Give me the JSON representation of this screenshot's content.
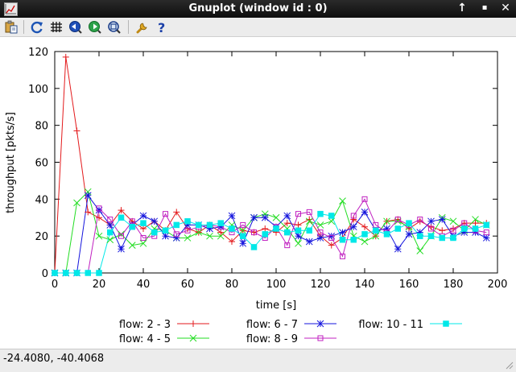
{
  "window": {
    "title": "Gnuplot (window id : 0)",
    "pin_glyph": "↑",
    "min_glyph": "▪",
    "close_glyph": "✕"
  },
  "toolbar": {
    "icons": [
      "copy-clipboard-icon",
      "replot-icon",
      "grid-icon",
      "zoom-previous-icon",
      "zoom-next-icon",
      "autoscale-icon",
      "settings-icon",
      "help-icon"
    ]
  },
  "status": {
    "coords": "-24.4080, -40.4068"
  },
  "colors": {
    "flow_2_3": "#e31a1c",
    "flow_4_5": "#22dd22",
    "flow_6_7": "#1515dd",
    "flow_8_9": "#c020c0",
    "flow_10_11": "#00e8e8"
  },
  "chart_data": {
    "type": "line",
    "xlabel": "time [s]",
    "ylabel": "throughput [pkts/s]",
    "xlim": [
      0,
      200
    ],
    "ylim": [
      0,
      120
    ],
    "xticks": [
      0,
      20,
      40,
      60,
      80,
      100,
      120,
      140,
      160,
      180,
      200
    ],
    "yticks": [
      0,
      20,
      40,
      60,
      80,
      100,
      120
    ],
    "grid": false,
    "legend_position": "bottom",
    "series": [
      {
        "name": "flow: 2 - 3",
        "marker": "plus",
        "color": "#e31a1c",
        "x": [
          0,
          5,
          10,
          15,
          20,
          25,
          30,
          35,
          40,
          45,
          50,
          55,
          60,
          65,
          70,
          75,
          80,
          85,
          90,
          95,
          100,
          105,
          110,
          115,
          120,
          125,
          130,
          135,
          140,
          145,
          150,
          155,
          160,
          165,
          170,
          175,
          180,
          185,
          190,
          195
        ],
        "y": [
          0,
          117,
          77,
          33,
          30,
          26,
          34,
          28,
          24,
          28,
          23,
          33,
          24,
          22,
          26,
          22,
          17,
          23,
          22,
          24,
          22,
          27,
          26,
          29,
          20,
          15,
          19,
          29,
          25,
          20,
          28,
          29,
          24,
          28,
          25,
          23,
          24,
          27,
          27,
          27
        ]
      },
      {
        "name": "flow: 4 - 5",
        "marker": "x",
        "color": "#22dd22",
        "x": [
          0,
          5,
          10,
          15,
          20,
          25,
          30,
          35,
          40,
          45,
          50,
          55,
          60,
          65,
          70,
          75,
          80,
          85,
          90,
          95,
          100,
          105,
          110,
          115,
          120,
          125,
          130,
          135,
          140,
          145,
          150,
          155,
          160,
          165,
          170,
          175,
          180,
          185,
          190,
          195
        ],
        "y": [
          0,
          0,
          38,
          44,
          20,
          18,
          21,
          15,
          16,
          24,
          23,
          19,
          19,
          22,
          20,
          20,
          26,
          23,
          30,
          32,
          30,
          24,
          16,
          28,
          26,
          28,
          39,
          20,
          17,
          20,
          28,
          28,
          25,
          12,
          20,
          30,
          28,
          23,
          29,
          26
        ]
      },
      {
        "name": "flow: 6 - 7",
        "marker": "star",
        "color": "#1515dd",
        "x": [
          0,
          5,
          10,
          15,
          20,
          25,
          30,
          35,
          40,
          45,
          50,
          55,
          60,
          65,
          70,
          75,
          80,
          85,
          90,
          95,
          100,
          105,
          110,
          115,
          120,
          125,
          130,
          135,
          140,
          145,
          150,
          155,
          160,
          165,
          170,
          175,
          180,
          185,
          190,
          195
        ],
        "y": [
          0,
          0,
          0,
          42,
          34,
          26,
          13,
          26,
          31,
          28,
          20,
          19,
          26,
          26,
          24,
          25,
          31,
          16,
          30,
          30,
          25,
          31,
          20,
          17,
          19,
          20,
          22,
          25,
          33,
          23,
          24,
          13,
          21,
          22,
          28,
          29,
          20,
          22,
          22,
          19
        ]
      },
      {
        "name": "flow: 8 - 9",
        "marker": "box",
        "color": "#c020c0",
        "x": [
          0,
          5,
          10,
          15,
          20,
          25,
          30,
          35,
          40,
          45,
          50,
          55,
          60,
          65,
          70,
          75,
          80,
          85,
          90,
          95,
          100,
          105,
          110,
          115,
          120,
          125,
          130,
          135,
          140,
          145,
          150,
          155,
          160,
          165,
          170,
          175,
          180,
          185,
          190,
          195
        ],
        "y": [
          0,
          0,
          0,
          0,
          35,
          29,
          20,
          28,
          19,
          20,
          32,
          21,
          23,
          25,
          26,
          25,
          22,
          26,
          22,
          19,
          25,
          15,
          32,
          33,
          22,
          19,
          9,
          31,
          40,
          26,
          22,
          29,
          26,
          29,
          24,
          20,
          23,
          27,
          23,
          22
        ]
      },
      {
        "name": "flow: 10 - 11",
        "marker": "filled-box",
        "color": "#00e8e8",
        "x": [
          0,
          5,
          10,
          15,
          20,
          25,
          30,
          35,
          40,
          45,
          50,
          55,
          60,
          65,
          70,
          75,
          80,
          85,
          90,
          95,
          100,
          105,
          110,
          115,
          120,
          125,
          130,
          135,
          140,
          145,
          150,
          155,
          160,
          165,
          170,
          175,
          180,
          185,
          190,
          195
        ],
        "y": [
          0,
          0,
          0,
          0,
          0,
          22,
          30,
          25,
          27,
          22,
          23,
          26,
          28,
          26,
          26,
          27,
          24,
          20,
          14,
          21,
          24,
          22,
          23,
          23,
          32,
          31,
          18,
          18,
          21,
          23,
          21,
          24,
          27,
          20,
          20,
          19,
          19,
          24,
          24,
          26
        ]
      }
    ]
  }
}
